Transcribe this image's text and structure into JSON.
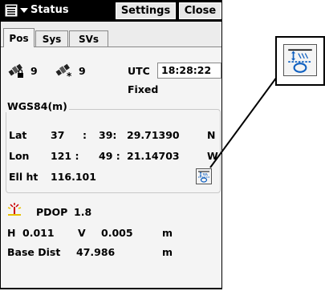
{
  "title_bar": {
    "menu_icon": "start-menu-icon",
    "title": "Status",
    "settings_label": "Settings",
    "close_label": "Close"
  },
  "tabs": [
    {
      "label": "Pos",
      "active": true
    },
    {
      "label": "Sys",
      "active": false
    },
    {
      "label": "SVs",
      "active": false
    }
  ],
  "satellites": {
    "locked_count": "9",
    "tracked_count": "9",
    "utc_label": "UTC",
    "utc_time": "18:28:22",
    "fix_status": "Fixed"
  },
  "position": {
    "group_title": "WGS84(m)",
    "lat_label": "Lat",
    "lat_deg": "37",
    "lat_min": "39:",
    "lat_sec": "29.71390",
    "lat_hem": "N",
    "lon_label": "Lon",
    "lon_deg": "121 :",
    "lon_min": "49 :",
    "lon_sec": "21.14703",
    "lon_hem": "W",
    "ellht_label": "Ell ht",
    "ellht_value": "116.101",
    "sep1": ":",
    "sep2": ":"
  },
  "precision": {
    "pdop_label": "PDOP",
    "pdop_value": "1.8",
    "h_label": "H",
    "h_value": "0.011",
    "v_label": "V",
    "v_value": "0.005",
    "hv_unit": "m",
    "base_label": "Base Dist",
    "base_value": "47.986",
    "base_unit": "m"
  },
  "colors": {
    "title_bar": "#000000",
    "panel": "#f4f4f4",
    "antenna_red": "#cc0000",
    "antenna_yellow": "#e8c000",
    "icon_blue": "#1060c0"
  }
}
